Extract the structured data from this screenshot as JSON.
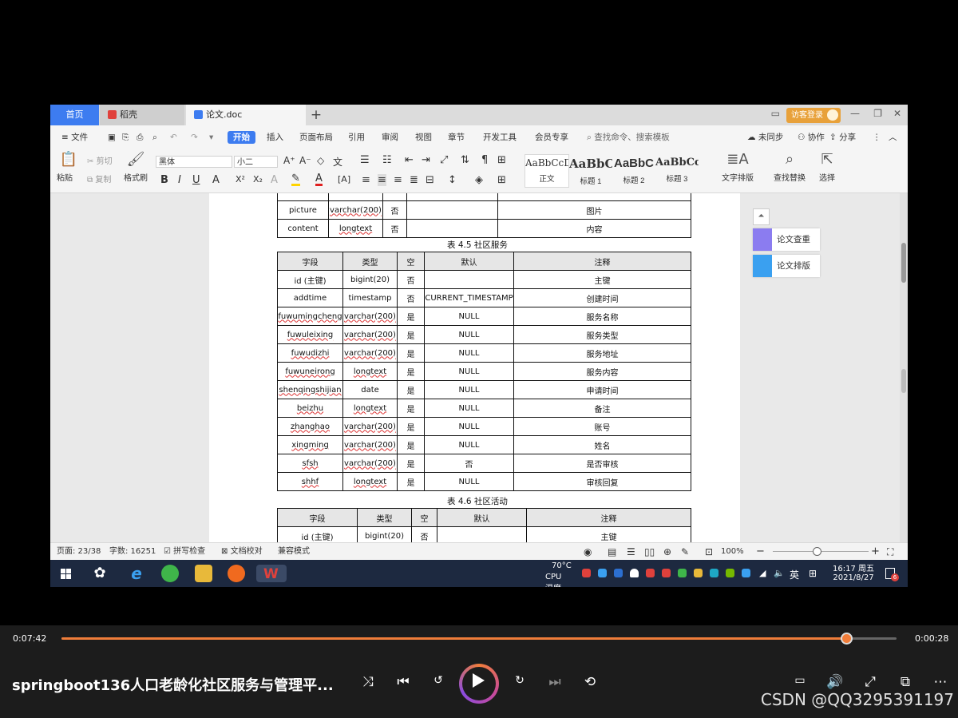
{
  "app": {
    "tabs": {
      "home": "首页",
      "dao": "稻壳",
      "doc": "论文.doc",
      "add": "+"
    },
    "login": "访客登录"
  },
  "menu": {
    "file": "文件",
    "items": [
      "开始",
      "插入",
      "页面布局",
      "引用",
      "审阅",
      "视图",
      "章节",
      "开发工具",
      "会员专享"
    ],
    "search": "查找命令、搜索模板",
    "right": [
      "未同步",
      "协作",
      "分享"
    ]
  },
  "ribbon": {
    "paste": "粘贴",
    "cut": "剪切",
    "copy": "复制",
    "format_painter": "格式刷",
    "font": "黑体",
    "size": "小二",
    "styles": [
      {
        "sample": "AaBbCcDd",
        "name": "正文"
      },
      {
        "sample": "AaBbC",
        "name": "标题 1"
      },
      {
        "sample": "AaBbC",
        "name": "标题 2"
      },
      {
        "sample": "AaBbCcI",
        "name": "标题 3"
      }
    ],
    "text_layout": "文字排版",
    "find_replace": "查找替换",
    "select": "选择"
  },
  "doc": {
    "top_rows": [
      [
        "picture",
        "varchar(200)",
        "否",
        "",
        "图片"
      ],
      [
        "content",
        "longtext",
        "否",
        "",
        "内容"
      ]
    ],
    "table45": {
      "caption": "表 4.5 社区服务",
      "headers": [
        "字段",
        "类型",
        "空",
        "默认",
        "注释"
      ],
      "rows": [
        [
          "id (主键)",
          "bigint(20)",
          "否",
          "",
          "主键"
        ],
        [
          "addtime",
          "timestamp",
          "否",
          "CURRENT_TIMESTAMP",
          "创建时间"
        ],
        [
          "fuwumingcheng",
          "varchar(200)",
          "是",
          "NULL",
          "服务名称"
        ],
        [
          "fuwuleixing",
          "varchar(200)",
          "是",
          "NULL",
          "服务类型"
        ],
        [
          "fuwudizhi",
          "varchar(200)",
          "是",
          "NULL",
          "服务地址"
        ],
        [
          "fuwuneirong",
          "longtext",
          "是",
          "NULL",
          "服务内容"
        ],
        [
          "shenqingshijian",
          "date",
          "是",
          "NULL",
          "申请时间"
        ],
        [
          "beizhu",
          "longtext",
          "是",
          "NULL",
          "备注"
        ],
        [
          "zhanghao",
          "varchar(200)",
          "是",
          "NULL",
          "账号"
        ],
        [
          "xingming",
          "varchar(200)",
          "是",
          "NULL",
          "姓名"
        ],
        [
          "sfsh",
          "varchar(200)",
          "是",
          "否",
          "是否审核"
        ],
        [
          "shhf",
          "longtext",
          "是",
          "NULL",
          "审核回复"
        ]
      ]
    },
    "table46": {
      "caption": "表 4.6 社区活动",
      "headers": [
        "字段",
        "类型",
        "空",
        "默认",
        "注释"
      ],
      "rows": [
        [
          "id (主键)",
          "bigint(20)",
          "否",
          "",
          "主键"
        ]
      ]
    }
  },
  "right_panel": {
    "check": "论文查重",
    "layout": "论文排版"
  },
  "status": {
    "page": "页面: 23/38",
    "words": "字数: 16251",
    "spell": "拼写检查",
    "proof": "文档校对",
    "compat": "兼容模式",
    "zoom": "100%"
  },
  "taskbar": {
    "temp": "70°C",
    "cpu": "CPU温度",
    "ime": "英",
    "time": "16:17 周五",
    "date": "2021/8/27",
    "badge": "6"
  },
  "player": {
    "current": "0:07:42",
    "total": "0:00:28",
    "progress": 0.94,
    "title": "springboot136人口老龄化社区服务与管理平...",
    "watermark": "CSDN @QQ3295391197",
    "accent": "#f07d3a"
  }
}
